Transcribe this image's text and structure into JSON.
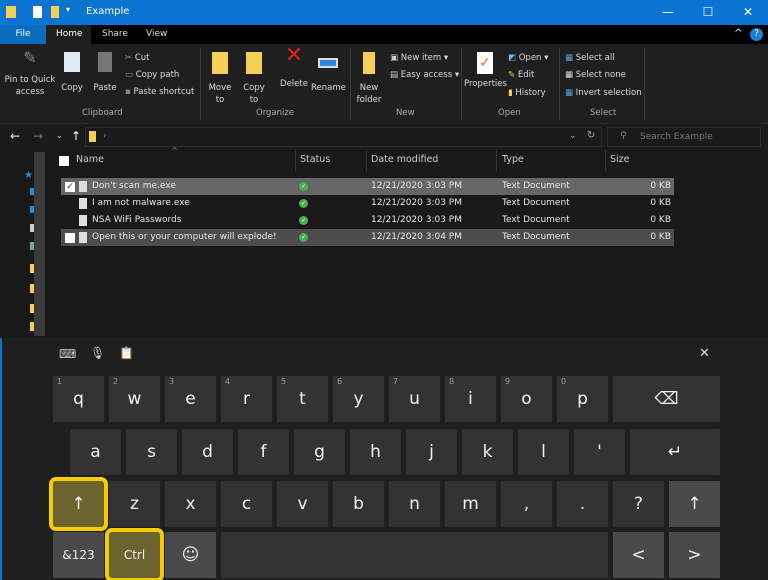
{
  "window": {
    "title": "Example",
    "minimize": "—",
    "maximize": "☐",
    "close": "✕",
    "help": "?",
    "collapse": "^"
  },
  "tabs": [
    "File",
    "Home",
    "Share",
    "View"
  ],
  "ribbon": {
    "clipboard": {
      "group": "Clipboard",
      "pin": "Pin to Quick access",
      "copy": "Copy",
      "paste": "Paste",
      "cut": "Cut",
      "copy_path": "Copy path",
      "paste_shortcut": "Paste shortcut"
    },
    "organize": {
      "group": "Organize",
      "move_to": "Move to",
      "copy_to": "Copy to",
      "delete": "Delete",
      "rename": "Rename"
    },
    "new": {
      "group": "New",
      "new_folder": "New folder",
      "new_item": "New item",
      "easy_access": "Easy access"
    },
    "open": {
      "group": "Open",
      "properties": "Properties",
      "open": "Open",
      "edit": "Edit",
      "history": "History"
    },
    "select": {
      "group": "Select",
      "select_all": "Select all",
      "select_none": "Select none",
      "invert": "Invert selection"
    }
  },
  "address": {
    "search_placeholder": "Search Example"
  },
  "columns": {
    "name": "Name",
    "status": "Status",
    "date": "Date modified",
    "type": "Type",
    "size": "Size"
  },
  "files": [
    {
      "name": "Don't scan me.exe",
      "date": "12/21/2020 3:03 PM",
      "type": "Text Document",
      "size": "0 KB",
      "checked": true,
      "highlight": "selected"
    },
    {
      "name": "I am not malware.exe",
      "date": "12/21/2020 3:03 PM",
      "type": "Text Document",
      "size": "0 KB",
      "checked": false,
      "highlight": "none"
    },
    {
      "name": "NSA WiFi Passwords",
      "date": "12/21/2020 3:03 PM",
      "type": "Text Document",
      "size": "0 KB",
      "checked": false,
      "highlight": "none"
    },
    {
      "name": "Open this or your computer will explode!",
      "date": "12/21/2020 3:04 PM",
      "type": "Text Document",
      "size": "0 KB",
      "checked": false,
      "highlight": "hover"
    }
  ],
  "status_icon": "check-circle-icon",
  "status_color": "#4caf50",
  "highlight_color": "#f3cd00",
  "keyboard": {
    "close": "✕",
    "rows": [
      [
        {
          "l": "q",
          "h": "1"
        },
        {
          "l": "w",
          "h": "2"
        },
        {
          "l": "e",
          "h": "3"
        },
        {
          "l": "r",
          "h": "4"
        },
        {
          "l": "t",
          "h": "5"
        },
        {
          "l": "y",
          "h": "6"
        },
        {
          "l": "u",
          "h": "7"
        },
        {
          "l": "i",
          "h": "8"
        },
        {
          "l": "o",
          "h": "9"
        },
        {
          "l": "p",
          "h": "0"
        },
        {
          "l": "⌫",
          "kind": "backspace",
          "n": "backspace"
        }
      ],
      [
        {
          "l": "a"
        },
        {
          "l": "s"
        },
        {
          "l": "d"
        },
        {
          "l": "f"
        },
        {
          "l": "g"
        },
        {
          "l": "h"
        },
        {
          "l": "j"
        },
        {
          "l": "k"
        },
        {
          "l": "l"
        },
        {
          "l": "'"
        },
        {
          "l": "↵",
          "kind": "enter",
          "n": "enter"
        }
      ],
      [
        {
          "l": "↑",
          "n": "shift-left",
          "hl": true
        },
        {
          "l": "z"
        },
        {
          "l": "x"
        },
        {
          "l": "c"
        },
        {
          "l": "v"
        },
        {
          "l": "b"
        },
        {
          "l": "n"
        },
        {
          "l": "m"
        },
        {
          "l": ","
        },
        {
          "l": "."
        },
        {
          "l": "?"
        },
        {
          "l": "↑",
          "n": "shift-right",
          "special": true
        }
      ],
      [
        {
          "l": "&123",
          "n": "symbols",
          "special": true,
          "small": true
        },
        {
          "l": "Ctrl",
          "n": "ctrl",
          "hl": true,
          "small": true
        },
        {
          "l": "☺",
          "n": "emoji",
          "special": true
        },
        {
          "l": "",
          "kind": "space",
          "n": "space"
        },
        {
          "l": "<",
          "n": "left-arrow",
          "special": true
        },
        {
          "l": ">",
          "n": "right-arrow",
          "special": true
        }
      ]
    ]
  }
}
